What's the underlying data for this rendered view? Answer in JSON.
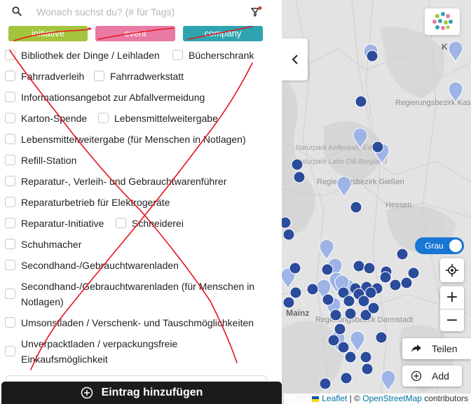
{
  "search": {
    "placeholder": "Wonach suchst du? (# für Tags)",
    "value": ""
  },
  "type_buttons": [
    {
      "label": "initiative",
      "color": "#a3c43c"
    },
    {
      "label": "event",
      "color": "#e87aa4"
    },
    {
      "label": "company",
      "color": "#2ea4b0"
    }
  ],
  "categories": [
    {
      "label": "Bibliothek der Dinge / Leihladen",
      "checked": false
    },
    {
      "label": "Bücherschrank",
      "checked": false
    },
    {
      "label": "Fahrradverleih",
      "checked": false
    },
    {
      "label": "Fahrradwerkstatt",
      "checked": false
    },
    {
      "label": "Informationsangebot zur Abfallvermeidung",
      "checked": false
    },
    {
      "label": "Karton-Spende",
      "checked": false
    },
    {
      "label": "Lebensmittelweitergabe",
      "checked": false
    },
    {
      "label": "Lebensmittelweitergabe (für Menschen in Notlagen)",
      "checked": false
    },
    {
      "label": "Refill-Station",
      "checked": false
    },
    {
      "label": "Reparatur-, Verleih- und Gebrauchtwarenführer",
      "checked": false
    },
    {
      "label": "Reparaturbetrieb für Elektrogeräte",
      "checked": false
    },
    {
      "label": "Reparatur-Initiative",
      "checked": false
    },
    {
      "label": "Schneiderei",
      "checked": false
    },
    {
      "label": "Schuhmacher",
      "checked": false
    },
    {
      "label": "Secondhand-/Gebrauchtwarenladen",
      "checked": false
    },
    {
      "label": "Secondhand-/Gebrauchtwarenladen (für Menschen in Notlagen)",
      "checked": false
    },
    {
      "label": "Umsonstladen / Verschenk- und Tauschmöglichkeiten",
      "checked": false
    },
    {
      "label": "Unverpacktladen / verpackungsfreie Einkaufsmöglichkeit",
      "checked": false
    }
  ],
  "add_entry_label": "Eintrag hinzufügen",
  "map": {
    "labels": {
      "regierungsbezirk_kassel": "Regierungsbezirk Kassel",
      "naturpark_kellerwald": "Naturpark Kellerwald-Edersee",
      "naturpark_lahn_dill": "Naturpark Lahn-Dill-Bergland",
      "regierungsbezirk_giessen": "Regierungsbezirk Gießen",
      "hessen": "Hessen",
      "regierungsbezirk_darmstadt": "Regierungsbezirk Darmstadt",
      "mainz": "Mainz",
      "k": "K"
    },
    "toggle_label": "Grau",
    "share_label": "Teilen",
    "add_label": "Add",
    "zoom_in": "+",
    "zoom_out": "−",
    "attribution": {
      "leaflet": "Leaflet",
      "separator": " | © ",
      "osm": "OpenStreetMap",
      "suffix": " contributors"
    },
    "pin_colors": {
      "dark": "#2b4b9b",
      "light": "#9eb4e6"
    }
  }
}
